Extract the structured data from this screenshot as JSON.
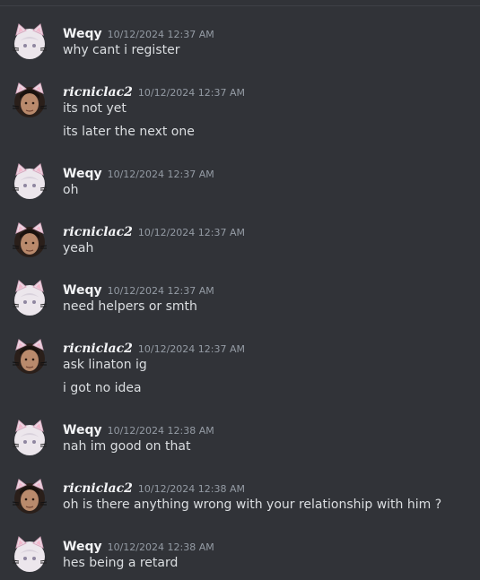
{
  "messages": [
    {
      "author": "Weqy",
      "timestamp": "10/12/2024 12:37 AM",
      "avatar": "cat-ear-anime-avatar",
      "lines": [
        "why cant i register"
      ]
    },
    {
      "author": "ricniclac2",
      "timestamp": "10/12/2024 12:37 AM",
      "avatar": "man-portrait-avatar",
      "lines": [
        "its not yet",
        "its later the next one"
      ]
    },
    {
      "author": "Weqy",
      "timestamp": "10/12/2024 12:37 AM",
      "avatar": "cat-ear-anime-avatar",
      "lines": [
        "oh"
      ]
    },
    {
      "author": "ricniclac2",
      "timestamp": "10/12/2024 12:37 AM",
      "avatar": "man-portrait-avatar",
      "lines": [
        "yeah"
      ]
    },
    {
      "author": "Weqy",
      "timestamp": "10/12/2024 12:37 AM",
      "avatar": "cat-ear-anime-avatar",
      "lines": [
        "need helpers or smth"
      ]
    },
    {
      "author": "ricniclac2",
      "timestamp": "10/12/2024 12:37 AM",
      "avatar": "man-portrait-avatar",
      "lines": [
        "ask linaton ig",
        "i got no idea"
      ]
    },
    {
      "author": "Weqy",
      "timestamp": "10/12/2024 12:38 AM",
      "avatar": "cat-ear-anime-avatar",
      "lines": [
        "nah im good on that"
      ]
    },
    {
      "author": "ricniclac2",
      "timestamp": "10/12/2024 12:38 AM",
      "avatar": "man-portrait-avatar",
      "lines": [
        "oh is there anything wrong with your relationship with him ?"
      ]
    },
    {
      "author": "Weqy",
      "timestamp": "10/12/2024 12:38 AM",
      "avatar": "cat-ear-anime-avatar",
      "lines": [
        "hes being a retard"
      ]
    }
  ],
  "colors": {
    "background": "#313338",
    "username": "#f2f3f5",
    "timestamp": "#949ba4",
    "text": "#dbdee1"
  }
}
